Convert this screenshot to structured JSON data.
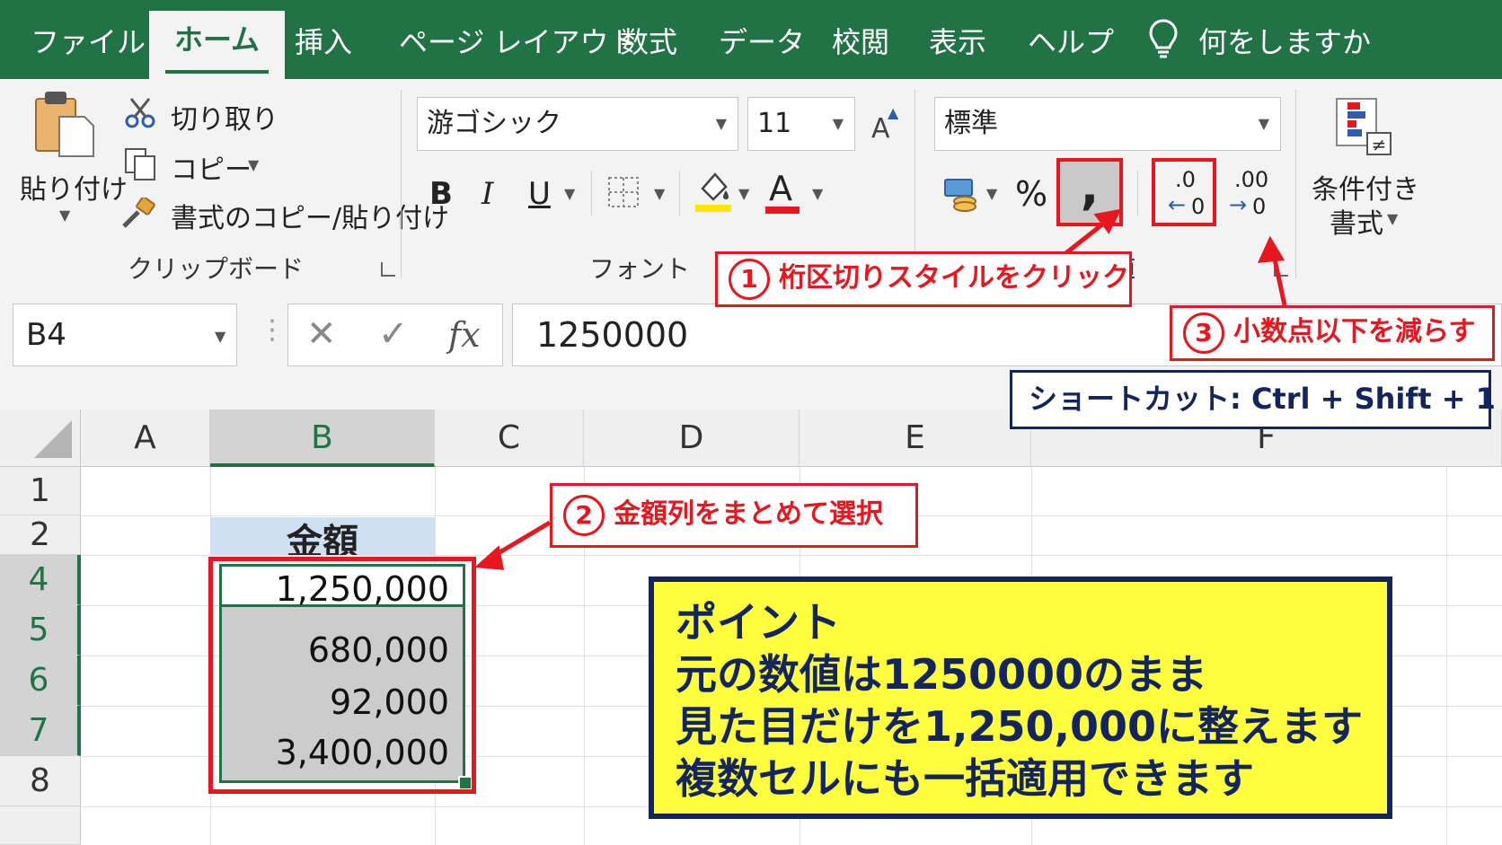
{
  "tabs": [
    "ファイル",
    "ホーム",
    "挿入",
    "ページ レイアウト",
    "数式",
    "データ",
    "校閲",
    "表示",
    "ヘルプ"
  ],
  "tell_me": "何をしますか",
  "clipboard": {
    "paste": "貼り付け",
    "cut": "切り取り",
    "copy": "コピー",
    "format_painter": "書式のコピー/貼り付け",
    "group_label": "クリップボード"
  },
  "font": {
    "name": "游ゴシック",
    "size": "11",
    "bold": "B",
    "italic": "I",
    "underline": "U",
    "font_color_letter": "A",
    "grow_letter": "A",
    "group_label": "フォント"
  },
  "number": {
    "format": "標準",
    "percent": "%",
    "comma": ",",
    "dec_decrease_top": ".0",
    "dec_decrease_bottom": "0",
    "dec_increase_top": ".00",
    "dec_increase_bottom": "0",
    "group_label": "数値"
  },
  "styles": {
    "conditional_line1": "条件付き",
    "conditional_line2": "書式"
  },
  "formula_bar": {
    "name_box": "B4",
    "fx": "fx",
    "value": "1250000"
  },
  "columns": [
    "A",
    "B",
    "C",
    "D",
    "E",
    "F"
  ],
  "rows": [
    "1",
    "2",
    "4",
    "5",
    "6",
    "7",
    "8"
  ],
  "cells": {
    "b2_header": "金額",
    "b4": "1,250,000",
    "b5": "680,000",
    "b6": "92,000",
    "b7": "3,400,000"
  },
  "callouts": {
    "step1_num": "1",
    "step1": "桁区切りスタイルをクリック",
    "step2_num": "2",
    "step2": "金額列をまとめて選択",
    "step3_num": "3",
    "step3": "小数点以下を減らす",
    "shortcut": "ショートカット: Ctrl + Shift + 1"
  },
  "point_box": {
    "title": "ポイント",
    "line1": "元の数値は1250000のまま",
    "line2": "見た目だけを1,250,000に整えます",
    "line3": "複数セルにも一括適用できます"
  },
  "colors": {
    "excel_green": "#217346",
    "callout_red": "#e8161e",
    "navy": "#13255c",
    "highlight_yellow": "#fefe3f"
  }
}
